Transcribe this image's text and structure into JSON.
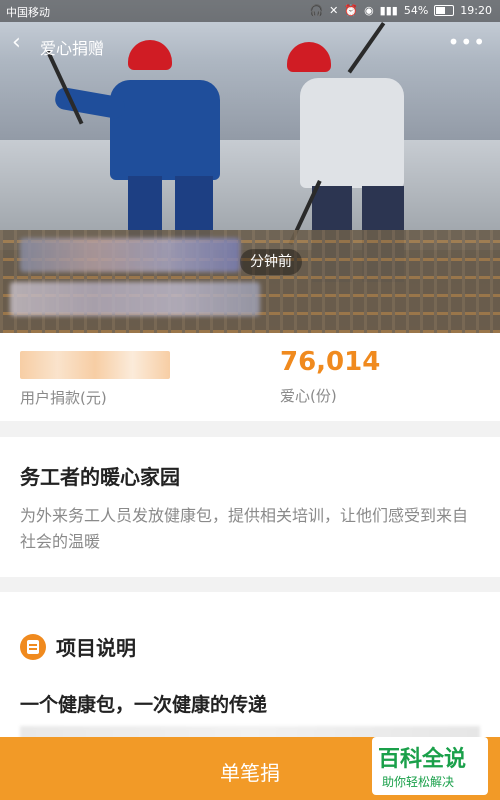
{
  "status_bar": {
    "carrier": "中国移动",
    "battery": "54%",
    "time": "19:20"
  },
  "navbar": {
    "back_icon": "chevron-left",
    "title": "爱心捐赠",
    "more_icon": "more-horizontal"
  },
  "hero": {
    "time_ago": "分钟前"
  },
  "stats": {
    "user_donation_label": "用户捐款(元)",
    "love_value": "76,014",
    "love_label": "爱心(份)"
  },
  "project": {
    "title": "务工者的暖心家园",
    "description": "为外来务工人员发放健康包，提供相关培训，让他们感受到来自社会的温暖"
  },
  "description_section": {
    "icon": "document-icon",
    "title": "项目说明",
    "subhead": "一个健康包，一次健康的传递"
  },
  "donate": {
    "button_label": "单笔捐"
  },
  "watermark": {
    "main": "百科全说",
    "sub": "助你轻松解决"
  },
  "colors": {
    "accent": "#f08a1e",
    "donate_bar": "#f29a27"
  }
}
